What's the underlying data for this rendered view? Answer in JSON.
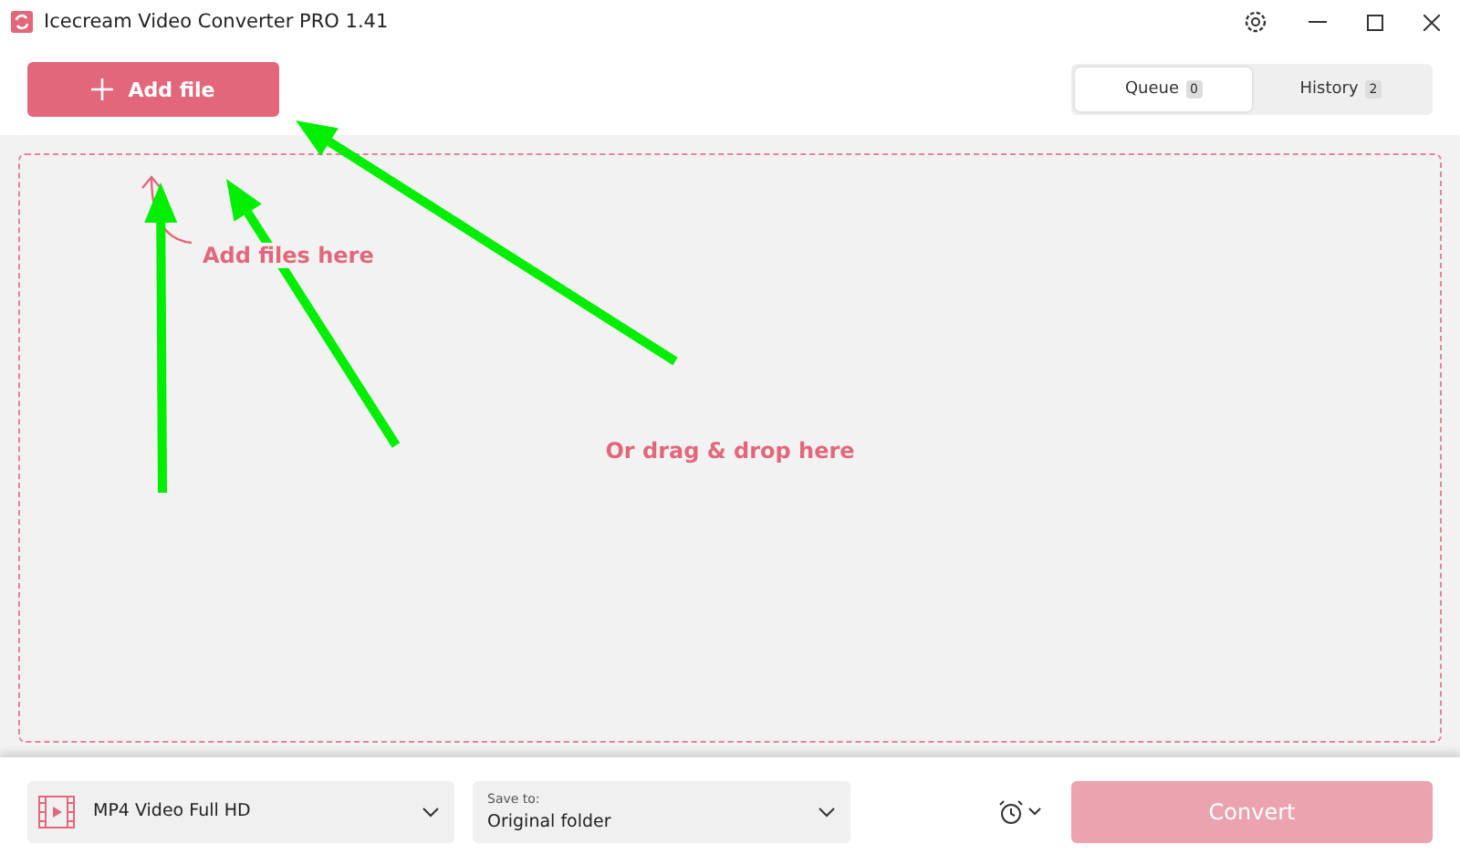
{
  "window": {
    "title": "Icecream Video Converter PRO 1.41"
  },
  "toolbar": {
    "add_button": "Add file"
  },
  "tabs": [
    {
      "label": "Queue",
      "count": "0",
      "selected": true
    },
    {
      "label": "History",
      "count": "2",
      "selected": false
    }
  ],
  "drop_zone": {
    "hint": "Add files here",
    "message": "Or drag & drop here"
  },
  "annotations": [
    {
      "kind": "arrow"
    },
    {
      "kind": "arrow"
    },
    {
      "kind": "arrow"
    }
  ],
  "bottom_bar": {
    "format": "MP4 Video Full HD",
    "save_label": "Save to:",
    "save_value": "Original folder",
    "convert": {
      "label": "Convert",
      "disabled": true
    }
  }
}
